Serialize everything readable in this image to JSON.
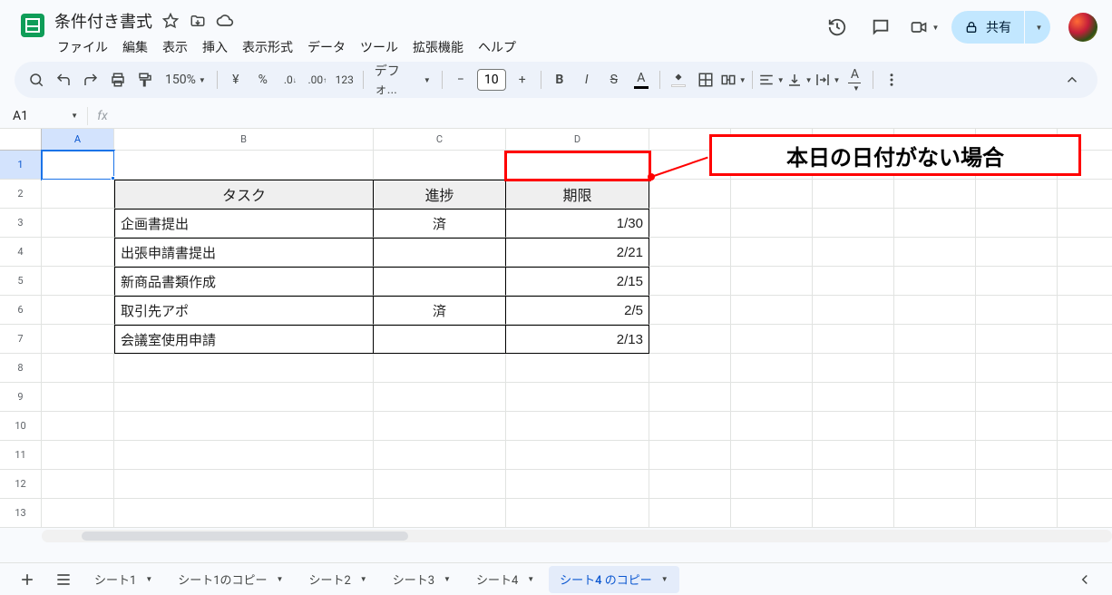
{
  "header": {
    "doc_title": "条件付き書式",
    "menus": [
      "ファイル",
      "編集",
      "表示",
      "挿入",
      "表示形式",
      "データ",
      "ツール",
      "拡張機能",
      "ヘルプ"
    ],
    "share_label": "共有"
  },
  "toolbar": {
    "zoom": "150%",
    "font": "デフォ...",
    "font_size": "10"
  },
  "fx": {
    "namebox": "A1",
    "formula": ""
  },
  "grid": {
    "columns": [
      "A",
      "B",
      "C",
      "D"
    ],
    "row_count": 13,
    "headers": {
      "task": "タスク",
      "progress": "進捗",
      "due": "期限"
    },
    "rows": [
      {
        "task": "企画書提出",
        "progress": "済",
        "due": "1/30"
      },
      {
        "task": "出張申請書提出",
        "progress": "",
        "due": "2/21"
      },
      {
        "task": "新商品書類作成",
        "progress": "",
        "due": "2/15"
      },
      {
        "task": "取引先アポ",
        "progress": "済",
        "due": "2/5"
      },
      {
        "task": "会議室使用申請",
        "progress": "",
        "due": "2/13"
      }
    ]
  },
  "annotation": {
    "text": "本日の日付がない場合"
  },
  "tabs": {
    "items": [
      "シート1",
      "シート1のコピー",
      "シート2",
      "シート3",
      "シート4",
      "シート4 のコピー"
    ],
    "active_index": 5
  }
}
